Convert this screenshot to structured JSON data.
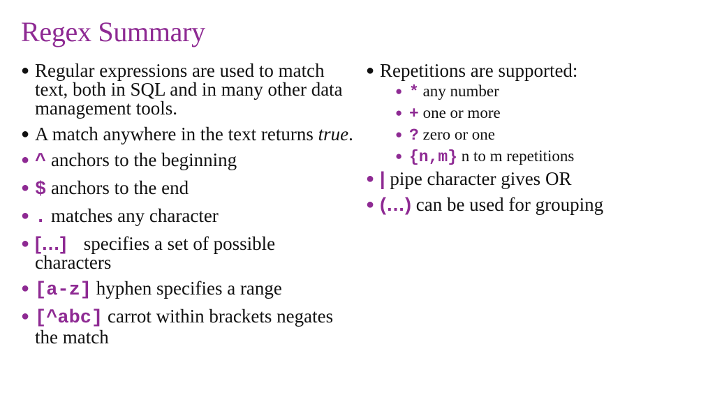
{
  "slide": {
    "title": "Regex Summary",
    "accent_color": "#8e2a93",
    "left_column": [
      {
        "symbol": null,
        "text": "Regular expressions are used to match text, both in SQL and in many other data management tools."
      },
      {
        "symbol": null,
        "text_before": "A match anywhere in the text returns ",
        "emphasis": "true",
        "text_after": "."
      },
      {
        "symbol": "^",
        "text": "anchors to the beginning"
      },
      {
        "symbol": "$",
        "text": "anchors to the end"
      },
      {
        "symbol": ".",
        "text": "matches any character"
      },
      {
        "symbol": "[…]",
        "text": "specifies a set of possible characters"
      },
      {
        "symbol": "[a-z]",
        "text": "hyphen specifies a range"
      },
      {
        "symbol": "[^abc]",
        "text": "carrot within brackets negates the match"
      }
    ],
    "right_column": {
      "repetitions": {
        "text": "Repetitions are supported:",
        "items": [
          {
            "symbol": "*",
            "text": "any number"
          },
          {
            "symbol": "+",
            "text": "one or more"
          },
          {
            "symbol": "?",
            "text": "zero or one"
          },
          {
            "symbol": "{n,m}",
            "text": "n to m repetitions"
          }
        ]
      },
      "others": [
        {
          "symbol": "|",
          "text": "pipe character gives OR"
        },
        {
          "symbol": "(…)",
          "text": "can be used for grouping"
        }
      ]
    }
  }
}
